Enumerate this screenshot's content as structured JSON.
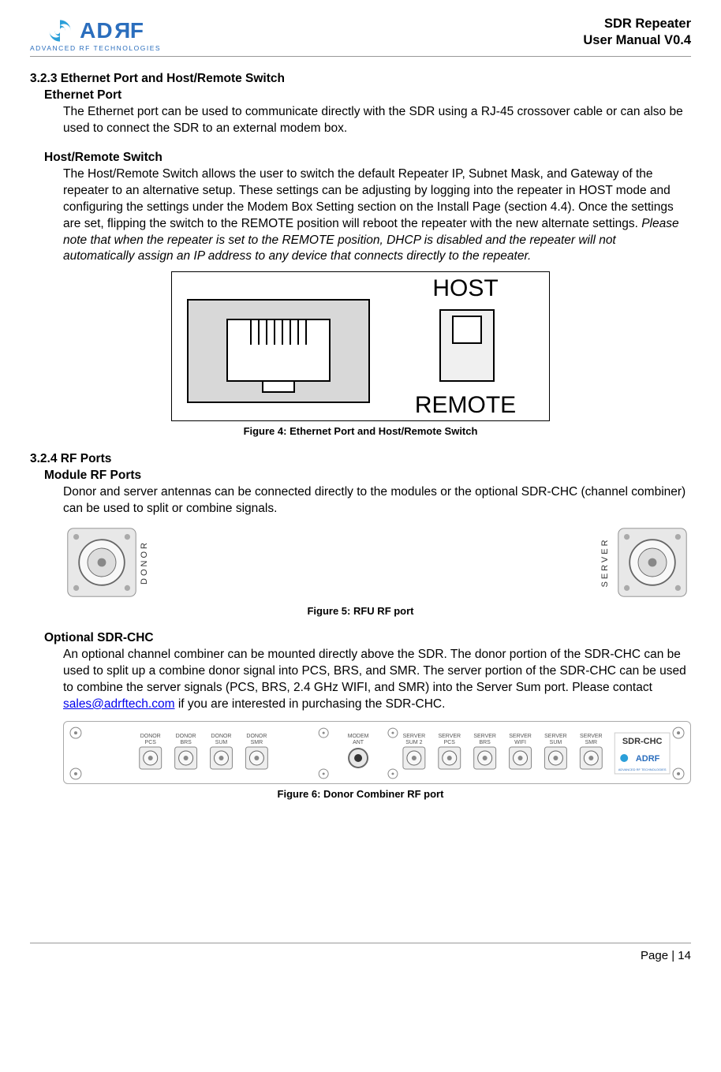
{
  "header": {
    "logo_text": "ADRF",
    "logo_sub": "ADVANCED RF TECHNOLOGIES",
    "right_line1": "SDR Repeater",
    "right_line2": "User Manual V0.4"
  },
  "sec323": {
    "num": "3.2.3 Ethernet Port and Host/Remote Switch",
    "sub1_head": "Ethernet Port",
    "sub1_body": "The Ethernet port can be used to communicate directly with the SDR using a RJ-45 crossover cable or can also be used to connect the SDR to an external modem box.",
    "sub2_head": "Host/Remote Switch",
    "sub2_body_a": "The Host/Remote Switch allows the user to switch the default Repeater IP, Subnet Mask, and Gateway of the repeater to an alternative setup.   These settings can be adjusting by logging into the repeater in HOST mode and configuring the settings under the Modem Box Setting section on the Install Page (section 4.4).   Once the settings are set, flipping the switch to the REMOTE position will reboot the repeater with the new alternate settings.  ",
    "sub2_body_b": "Please note that when the repeater is set to the REMOTE position,   DHCP is disabled and the repeater will not automatically assign an IP address to any device that connects directly to the repeater."
  },
  "fig4": {
    "caption": "Figure 4: Ethernet Port and Host/Remote Switch",
    "label_host": "HOST",
    "label_remote": "REMOTE"
  },
  "sec324": {
    "num": "3.2.4 RF Ports",
    "sub1_head": "Module RF Ports",
    "sub1_body": "Donor and server antennas can be connected directly to the modules or the optional SDR-CHC (channel combiner) can be used to split or combine signals.",
    "sub2_head": "Optional SDR-CHC",
    "sub2_body_a": "An optional channel combiner can be mounted directly above the SDR.   The donor portion of the SDR-CHC can be used to split up a combine donor signal into PCS, BRS, and SMR.   The server portion of the SDR-CHC can be used to combine the server signals (PCS, BRS, 2.4 GHz WIFI, and SMR) into the Server Sum port.   Please contact ",
    "sub2_link": "sales@adrftech.com",
    "sub2_body_b": " if you are interested in purchasing the SDR-CHC."
  },
  "fig5": {
    "caption": "Figure 5: RFU RF port",
    "left_label": "DONOR",
    "right_label": "SERVER"
  },
  "fig6": {
    "caption": "Figure 6: Donor Combiner RF port",
    "labels": [
      "DONOR PCS",
      "DONOR BRS",
      "DONOR SUM",
      "DONOR SMR",
      "MODEM ANT",
      "SERVER SUM 2",
      "SERVER PCS",
      "SERVER BRS",
      "SERVER WIFI",
      "SERVER SUM",
      "SERVER SMR"
    ],
    "brand": "SDR-CHC",
    "brand_sub": "ADRF"
  },
  "footer": {
    "page": "Page | 14"
  }
}
